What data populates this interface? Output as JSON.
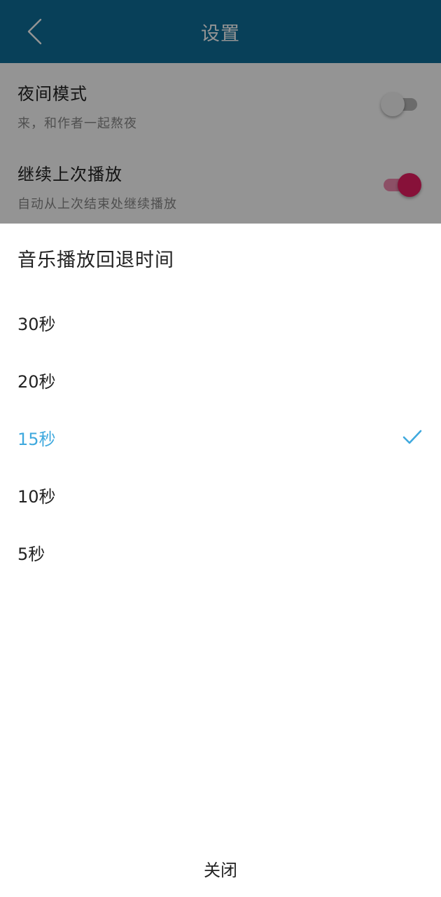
{
  "header": {
    "title": "设置",
    "back_icon": "chevron-left-icon"
  },
  "settings": [
    {
      "title": "夜间模式",
      "description": "来，和作者一起熬夜",
      "enabled": false
    },
    {
      "title": "继续上次播放",
      "description": "自动从上次结束处继续播放",
      "enabled": true
    }
  ],
  "sheet": {
    "title": "音乐播放回退时间",
    "options": [
      {
        "label": "30秒",
        "selected": false
      },
      {
        "label": "20秒",
        "selected": false
      },
      {
        "label": "15秒",
        "selected": true
      },
      {
        "label": "10秒",
        "selected": false
      },
      {
        "label": "5秒",
        "selected": false
      }
    ],
    "close_label": "关闭",
    "check_icon": "checkmark-icon"
  },
  "colors": {
    "header_bg": "#0f6e99",
    "accent": "#3fa9de",
    "switch_on": "#e91e63",
    "switch_on_track": "#f28ab0"
  }
}
